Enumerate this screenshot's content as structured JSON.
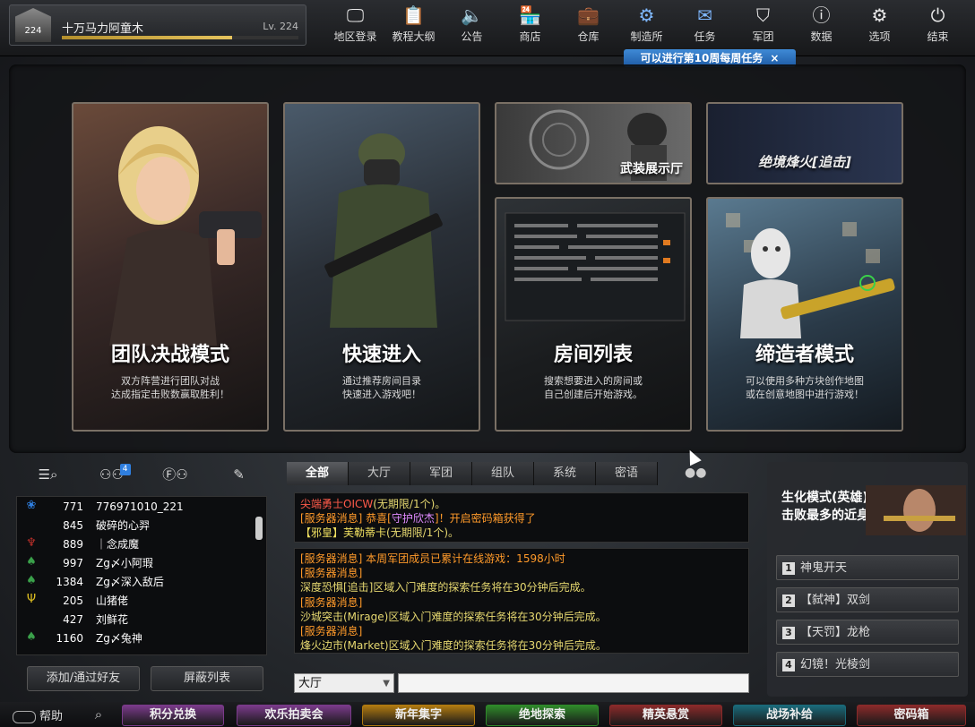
{
  "player": {
    "name": "十万马力阿童木",
    "level": "Lv. 224",
    "rank": "224",
    "xp_fraction": 0.72
  },
  "top_menu": [
    {
      "label": "地区登录",
      "icon": "monitor-icon"
    },
    {
      "label": "教程大纲",
      "icon": "clipboard-icon"
    },
    {
      "label": "公告",
      "icon": "speaker-icon"
    },
    {
      "label": "商店",
      "icon": "shop-icon"
    },
    {
      "label": "仓库",
      "icon": "briefcase-icon"
    },
    {
      "label": "制造所",
      "icon": "factory-icon"
    },
    {
      "label": "任务",
      "icon": "task-icon"
    },
    {
      "label": "军团",
      "icon": "shield-icon"
    },
    {
      "label": "数据",
      "icon": "info-icon"
    },
    {
      "label": "选项",
      "icon": "gear-icon"
    },
    {
      "label": "结束",
      "icon": "power-icon"
    }
  ],
  "notice": {
    "text": "可以进行第10周每周任务",
    "close": "×"
  },
  "modes": {
    "team": {
      "title": "团队决战模式",
      "desc1": "双方阵营进行团队对战",
      "desc2": "达成指定击败数赢取胜利！"
    },
    "quick": {
      "title": "快速进入",
      "desc1": "通过推荐房间目录",
      "desc2": "快速进入游戏吧！"
    },
    "armory": {
      "title": "武装展示厅"
    },
    "pursuit": {
      "title": "绝境烽火[追击]"
    },
    "rooms": {
      "title": "房间列表",
      "desc1": "搜索想要进入的房间或",
      "desc2": "自己创建后开始游戏。"
    },
    "creator": {
      "title": "缔造者模式",
      "desc1": "可以使用多种方块创作地图",
      "desc2": "或在创意地图中进行游戏！"
    }
  },
  "friends": {
    "badge": "4",
    "rows": [
      {
        "level": "771",
        "name": "776971010_221",
        "icon": "rose-icon",
        "color": "#2f7fe0"
      },
      {
        "level": "845",
        "name": "破碎的心羿",
        "icon": "",
        "color": ""
      },
      {
        "level": "889",
        "name": "｜念成魔",
        "icon": "wings-icon",
        "color": "#c0302a"
      },
      {
        "level": "997",
        "name": "Zg〆小阿瑕",
        "icon": "flame-icon",
        "color": "#3aa04a"
      },
      {
        "level": "1384",
        "name": "Zg〆深入敌后",
        "icon": "flame-icon",
        "color": "#3aa04a"
      },
      {
        "level": "205",
        "name": "山猪佬",
        "icon": "trident-icon",
        "color": "#e0c020"
      },
      {
        "level": "427",
        "name": "刘鲜花",
        "icon": "",
        "color": ""
      },
      {
        "level": "1160",
        "name": "Zg〆兔神",
        "icon": "flame-icon",
        "color": "#3aa04a"
      }
    ],
    "add_btn": "添加/通过好友",
    "block_btn": "屏蔽列表"
  },
  "chat": {
    "tabs": [
      "全部",
      "大厅",
      "军团",
      "组队",
      "系统",
      "密语"
    ],
    "top_lines": [
      {
        "a": "尖端勇士OICW",
        "b": "(无期限/1个)。",
        "ca": "red",
        "cb": "yl"
      },
      {
        "a": "[服务器消息] 恭喜[",
        "b": "守护欣杰",
        "c": "]！开启密码箱获得了",
        "ca": "org",
        "cb": "pk",
        "cc": "org"
      },
      {
        "a": "【邪皇】芙勒蒂卡",
        "b": "(无期限/1个)。",
        "ca": "grn",
        "cb": "yl"
      }
    ],
    "lines": [
      {
        "text": "[服务器消息] 本周军团成员已累计在线游戏：1598小时",
        "cls": "org"
      },
      {
        "text": "[服务器消息]",
        "cls": "org"
      },
      {
        "text": "深度恐惧[追击]区域入门难度的探索任务将在30分钟后完成。",
        "cls": "yl"
      },
      {
        "text": "[服务器消息]",
        "cls": "org"
      },
      {
        "text": "沙城突击(Mirage)区域入门难度的探索任务将在30分钟后完成。",
        "cls": "yl"
      },
      {
        "text": "[服务器消息]",
        "cls": "org"
      },
      {
        "text": "烽火边市(Market)区域入门难度的探索任务将在30分钟后完成。",
        "cls": "yl"
      }
    ],
    "channel": "大厅",
    "input_value": ""
  },
  "ranking": {
    "title1": "生化模式(英雄)",
    "title2": "击败最多的近身武器",
    "items": [
      {
        "num": "1",
        "label": "神鬼开天"
      },
      {
        "num": "2",
        "label": "【弑神】双剑"
      },
      {
        "num": "3",
        "label": "【天罚】龙枪"
      },
      {
        "num": "4",
        "label": "幻镜！光棱剑"
      }
    ]
  },
  "bottom": {
    "help": "帮助",
    "buttons": [
      {
        "label": "积分兑换",
        "color": "#7a3a8a"
      },
      {
        "label": "欢乐拍卖会",
        "color": "#7a3a8a"
      },
      {
        "label": "新年集字",
        "color": "#b07a10"
      },
      {
        "label": "绝地探索",
        "color": "#2f8a2a"
      },
      {
        "label": "精英悬赏",
        "color": "#8a2a2a"
      },
      {
        "label": "战场补给",
        "color": "#1a6a7a"
      },
      {
        "label": "密码箱",
        "color": "#8a2a2a"
      }
    ]
  }
}
